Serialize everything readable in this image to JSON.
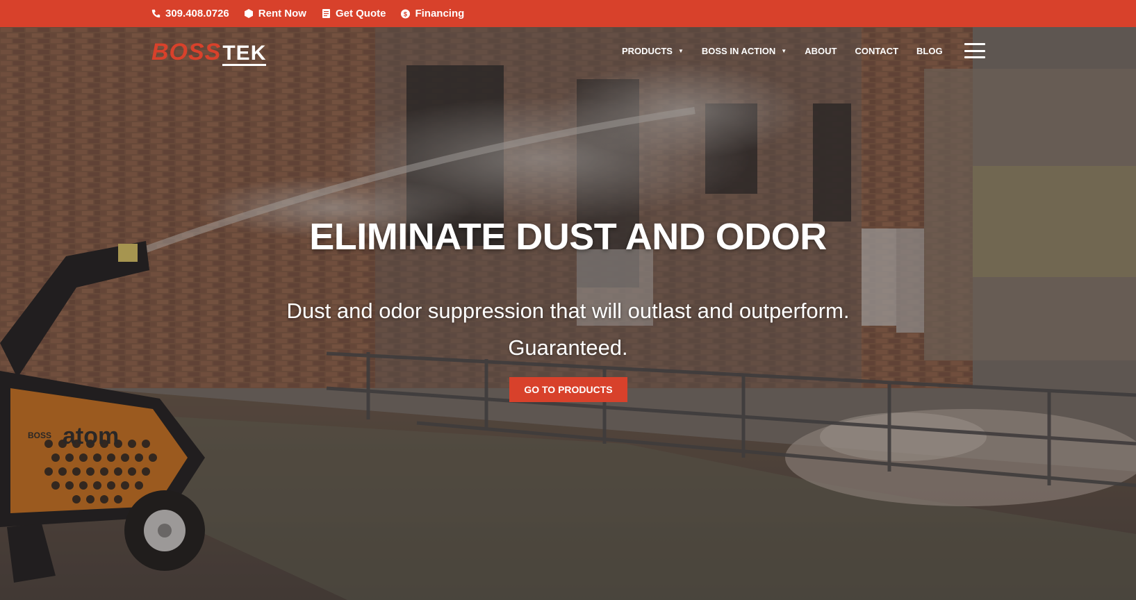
{
  "topbar": {
    "phone": "309.408.0726",
    "rent": "Rent Now",
    "quote": "Get Quote",
    "financing": "Financing"
  },
  "logo": {
    "part1": "BOSS",
    "part2": "TEK"
  },
  "nav": {
    "items": [
      {
        "label": "PRODUCTS",
        "dropdown": true
      },
      {
        "label": "BOSS IN ACTION",
        "dropdown": true
      },
      {
        "label": "ABOUT",
        "dropdown": false
      },
      {
        "label": "CONTACT",
        "dropdown": false
      },
      {
        "label": "BLOG",
        "dropdown": false
      }
    ],
    "caret": "▼"
  },
  "hero": {
    "title": "ELIMINATE DUST AND ODOR",
    "subtitle_line1": "Dust and odor suppression that will outlast and outperform.",
    "subtitle_line2": "Guaranteed.",
    "cta": "GO TO PRODUCTS"
  },
  "machine": {
    "brand": "BOSS",
    "model": "atom"
  },
  "colors": {
    "accent": "#d8412b",
    "text": "#ffffff"
  },
  "icons": {
    "phone": "phone-icon",
    "rent": "hexagon-icon",
    "quote": "document-icon",
    "financing": "dollar-icon",
    "menu": "hamburger-menu-icon"
  }
}
